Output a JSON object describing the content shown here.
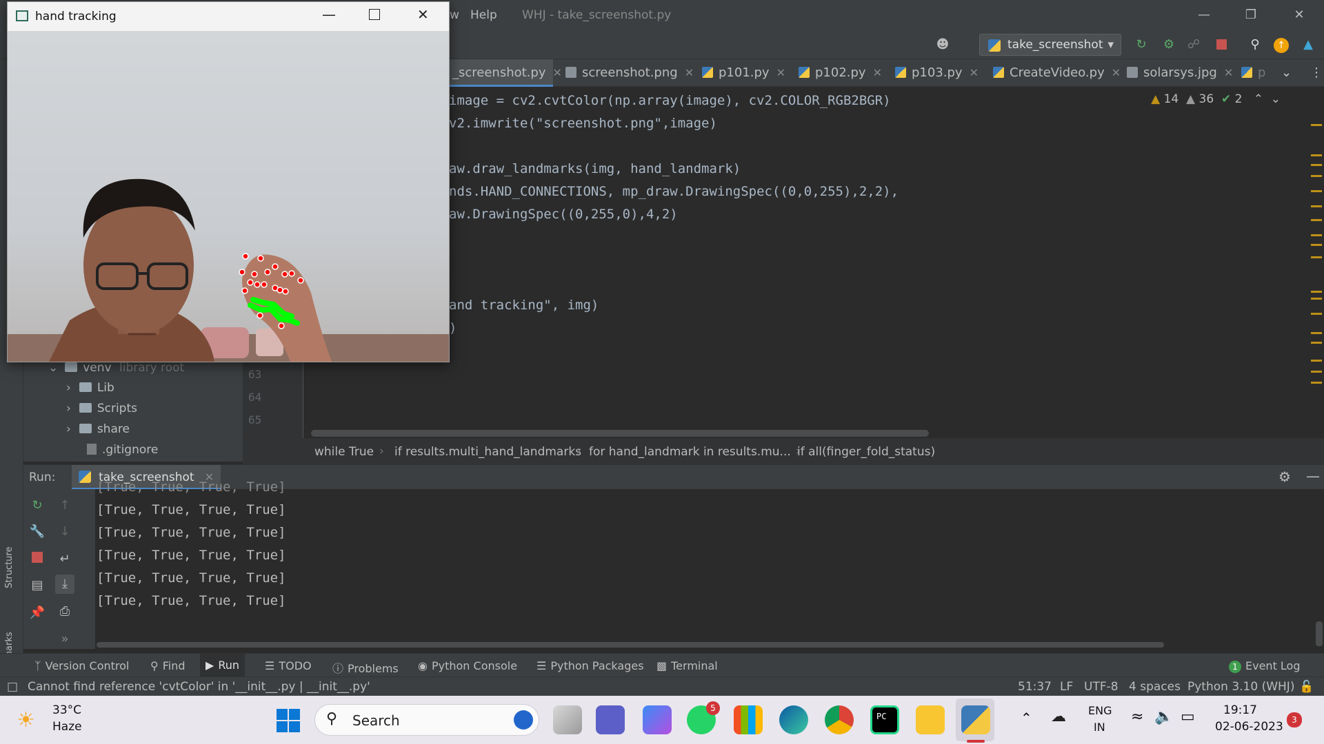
{
  "ide": {
    "menu_partial": "w",
    "menu_help": "Help",
    "window_title": "WHJ - take_screenshot.py",
    "run_config": "take_screenshot",
    "tabs": [
      {
        "label": "_screenshot.py",
        "active": true
      },
      {
        "label": "screenshot.png"
      },
      {
        "label": "p101.py"
      },
      {
        "label": "p102.py"
      },
      {
        "label": "p103.py"
      },
      {
        "label": "CreateVideo.py"
      },
      {
        "label": "solarsys.jpg"
      },
      {
        "label": "p"
      }
    ],
    "inspections": {
      "warnings": "14",
      "weak_warnings": "36",
      "typos": "2"
    },
    "code_lines": [
      "image = cv2.cvtColor(np.array(image), cv2.COLOR_RGB2BGR)",
      "v2.imwrite(\"screenshot.png\",image)",
      "",
      "",
      "aw.draw_landmarks(img, hand_landmark)",
      "nds.HAND_CONNECTIONS, mp_draw.DrawingSpec((0,0,255),2,2),",
      "aw.DrawingSpec((0,255,0),4,2)",
      "",
      "",
      "and tracking\", img)",
      ")"
    ],
    "line_numbers": [
      "63",
      "64",
      "65"
    ],
    "project_tree": [
      {
        "label": "venv",
        "suffix": "library root",
        "expanded": true
      },
      {
        "label": "Lib"
      },
      {
        "label": "Scripts"
      },
      {
        "label": "share"
      },
      {
        "label": ".gitignore"
      }
    ],
    "breadcrumb": [
      "while True",
      "if results.multi_hand_landmarks",
      "for hand_landmark in results.mu...",
      "if all(finger_fold_status)"
    ],
    "run_label": "Run:",
    "run_tab": "take_screenshot",
    "console_lines": [
      "[True, True, True, True]",
      "[True, True, True, True]",
      "[True, True, True, True]",
      "[True, True, True, True]",
      "[True, True, True, True]",
      "[True, True, True, True]"
    ],
    "left_strip": {
      "structure": "Structure",
      "bookmarks": "Bookmarks"
    },
    "tool_windows": [
      "Version Control",
      "Find",
      "Run",
      "TODO",
      "Problems",
      "Python Console",
      "Python Packages",
      "Terminal"
    ],
    "event_log": "Event Log",
    "event_log_count": "1",
    "status_message": "Cannot find reference 'cvtColor' in '__init__.py | __init__.py'",
    "status": {
      "position": "51:37",
      "line_sep": "LF",
      "encoding": "UTF-8",
      "indent": "4 spaces",
      "interpreter": "Python 3.10 (WHJ)"
    }
  },
  "hand_window": {
    "title": "hand tracking"
  },
  "taskbar": {
    "temperature": "33°C",
    "weather": "Haze",
    "search": "Search",
    "whatsapp_badge": "5",
    "lang": "ENG",
    "region": "IN",
    "time": "19:17",
    "date": "02-06-2023",
    "notif_count": "3"
  },
  "colors": {
    "accent": "#4a88c7",
    "warning": "#be9117",
    "landmark_red": "#ff0000",
    "connection_green": "#00ff00"
  }
}
